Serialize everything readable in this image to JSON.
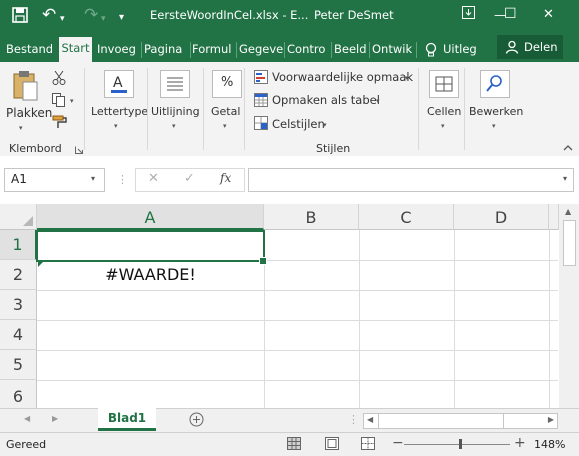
{
  "titlebar": {
    "filename": "EersteWoordInCel.xlsx - E...",
    "user": "Peter DeSmet",
    "icons": [
      "save-icon",
      "undo-icon",
      "redo-icon",
      "customize-icon",
      "ribbon-display-icon",
      "minimize-icon",
      "restore-icon",
      "close-icon"
    ],
    "glyphs": {
      "undo": "↶",
      "redo": "↷",
      "customize": "▾",
      "ribbon": "▣",
      "minimize": "—",
      "restore": "☐",
      "close": "✕"
    }
  },
  "tabs": [
    "Bestand",
    "Start",
    "Invoeg",
    "Pagina",
    "Formul",
    "Gegeve",
    "Contro",
    "Beeld",
    "Ontwik"
  ],
  "active_tab": "Start",
  "tell_me": "Uitleg",
  "share": "Delen",
  "ribbon": {
    "paste": "Plakken",
    "clipboard_group": "Klembord",
    "font": "Lettertype",
    "alignment": "Uitlijning",
    "number": "Getal",
    "number_symbol": "%",
    "conditional": "Voorwaardelijke opmaak",
    "format_table": "Opmaken als tabel",
    "cell_styles": "Celstijlen",
    "styles_group": "Stijlen",
    "cells": "Cellen",
    "editing": "Bewerken"
  },
  "formula_bar": {
    "name_box": "A1",
    "fx": "fx",
    "cancel": "✕",
    "enter": "✓",
    "formula": ""
  },
  "grid": {
    "columns": [
      "A",
      "B",
      "C",
      "D"
    ],
    "rows": [
      "1",
      "2",
      "3",
      "4",
      "5",
      "6"
    ],
    "cells": {
      "A2": "#WAARDE!"
    },
    "selected": "A1"
  },
  "sheets": [
    "Blad1"
  ],
  "status": {
    "ready": "Gereed",
    "zoom": "148%",
    "minus": "−",
    "plus": "+"
  },
  "colors": {
    "excel_green": "#217346",
    "selection": "#217346"
  }
}
